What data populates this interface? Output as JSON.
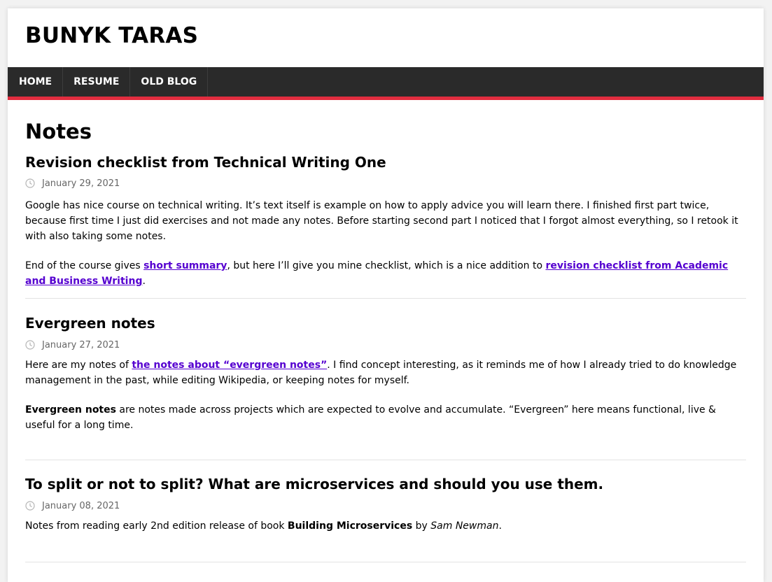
{
  "site": {
    "title": "BUNYK TARAS"
  },
  "nav": {
    "items": [
      "HOME",
      "RESUME",
      "OLD BLOG"
    ]
  },
  "page_heading": "Notes",
  "colors": {
    "accent": "#e22d3f",
    "nav_bg": "#2a2a2a",
    "link": "#5500d0"
  },
  "articles": [
    {
      "title": "Revision checklist from Technical Writing One",
      "date": "January 29, 2021",
      "p1": "Google has nice course on technical writing. It’s text itself is example on how to apply advice you will learn there. I finished first part twice, because first time I just did exercises and not made any notes. Before starting second part I noticed that I forgot almost everything, so I retook it with also taking some notes.",
      "p2_before": "End of the course gives ",
      "p2_link1": "short summary",
      "p2_middle": ", but here I’ll give you mine checklist, which is a nice addition to ",
      "p2_link2": "revision checklist from Academic and Business Writing",
      "p2_after": "."
    },
    {
      "title": "Evergreen notes",
      "date": "January 27, 2021",
      "p1_before": "Here are my notes of ",
      "p1_link": "the notes about “evergreen notes”",
      "p1_after": ". I find concept interesting, as it reminds me of how I already tried to do knowledge management in the past, while editing Wikipedia, or keeping notes for myself.",
      "p2_bold": "Evergreen notes",
      "p2_after": " are notes made across projects which are expected to evolve and accumulate. “Evergreen” here means functional, live & useful for a long time."
    },
    {
      "title": "To split or not to split? What are microservices and should you use them.",
      "date": "January 08, 2021",
      "p1_before": "Notes from reading early 2nd edition release of book ",
      "p1_bold": "Building Microservices",
      "p1_middle": " by ",
      "p1_italic": "Sam Newman",
      "p1_after": "."
    }
  ]
}
